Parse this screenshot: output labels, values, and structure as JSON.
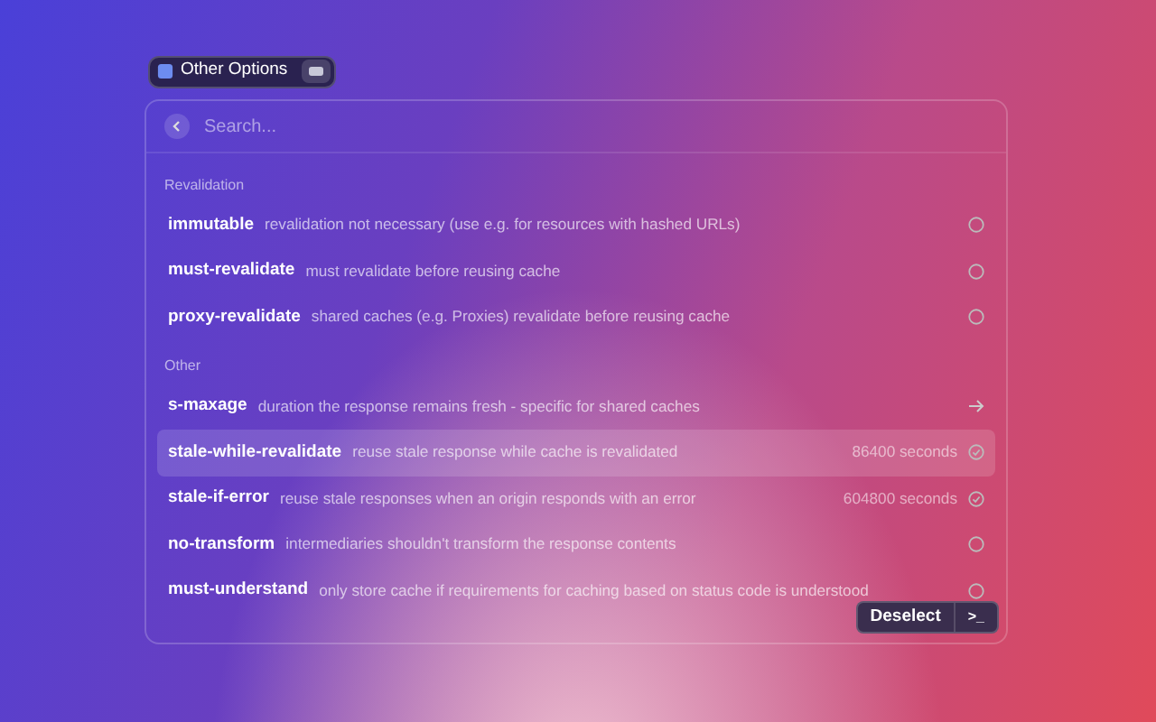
{
  "context_pill": {
    "label": "Other Options"
  },
  "search": {
    "placeholder": "Search..."
  },
  "sections": [
    {
      "title": "Revalidation",
      "items": [
        {
          "kind": "option",
          "name": "immutable",
          "description": "revalidation not necessary (use e.g. for resources with hashed URLs)",
          "checked": false,
          "selected": false
        },
        {
          "kind": "option",
          "name": "must-revalidate",
          "description": "must revalidate before reusing cache",
          "checked": false,
          "selected": false
        },
        {
          "kind": "option",
          "name": "proxy-revalidate",
          "description": "shared caches (e.g. Proxies) revalidate before reusing cache",
          "checked": false,
          "selected": false
        }
      ]
    },
    {
      "title": "Other",
      "items": [
        {
          "kind": "submenu",
          "name": "s-maxage",
          "description": "duration the response remains fresh - specific for shared caches",
          "selected": false
        },
        {
          "kind": "option",
          "name": "stale-while-revalidate",
          "description": "reuse stale response while cache is revalidated",
          "value": "86400 seconds",
          "checked": true,
          "selected": true
        },
        {
          "kind": "option",
          "name": "stale-if-error",
          "description": "reuse stale responses when an origin responds with an error",
          "value": "604800 seconds",
          "checked": true,
          "selected": false
        },
        {
          "kind": "option",
          "name": "no-transform",
          "description": "intermediaries shouldn't transform the response contents",
          "checked": false,
          "selected": false
        },
        {
          "kind": "option",
          "name": "must-understand",
          "description": "only store cache if requirements for caching based on status code is understood",
          "checked": false,
          "selected": false
        }
      ]
    }
  ],
  "footer": {
    "button": "Deselect",
    "shortcut": ">_"
  }
}
